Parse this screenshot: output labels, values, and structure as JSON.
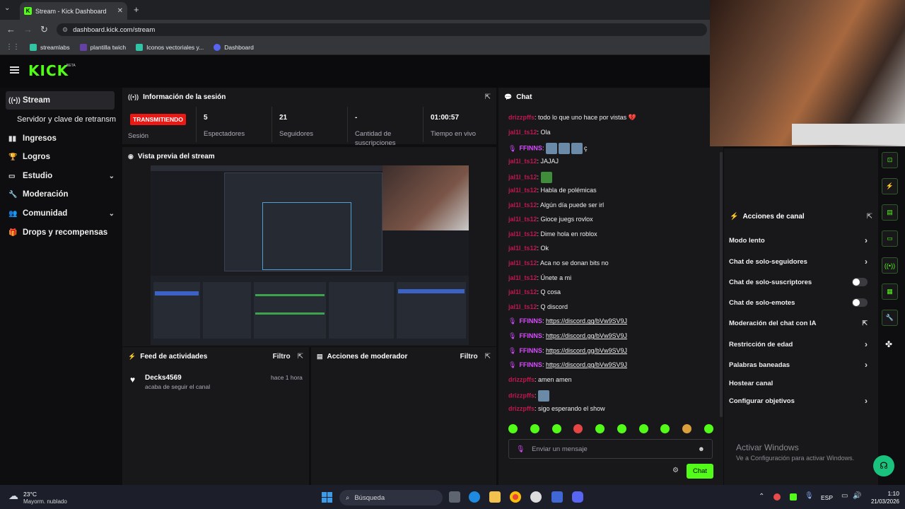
{
  "browser": {
    "tab_title": "Stream - Kick Dashboard",
    "url": "dashboard.kick.com/stream",
    "bookmarks": [
      "streamlabs",
      "plantilla twich",
      "Iconos vectoriales y...",
      "Dashboard"
    ]
  },
  "brand": {
    "logo": "KICK",
    "beta": "BETA",
    "accent": "#53fc18"
  },
  "sidebar": {
    "items": [
      {
        "label": "Stream",
        "icon": "broadcast-icon"
      },
      {
        "label": "Servidor y clave de retransm",
        "icon": ""
      },
      {
        "label": "Ingresos",
        "icon": "chart-icon"
      },
      {
        "label": "Logros",
        "icon": "trophy-icon"
      },
      {
        "label": "Estudio",
        "icon": "studio-icon"
      },
      {
        "label": "Moderación",
        "icon": "wrench-icon"
      },
      {
        "label": "Comunidad",
        "icon": "people-icon"
      },
      {
        "label": "Drops y recompensas",
        "icon": "gift-icon"
      }
    ]
  },
  "session": {
    "title": "Información de la sesión",
    "status": "TRANSMITIENDO",
    "status_label": "Sesión",
    "stats": [
      {
        "value": "5",
        "label": "Espectadores"
      },
      {
        "value": "21",
        "label": "Seguidores"
      },
      {
        "value": "-",
        "label": "Cantidad de suscripciones"
      },
      {
        "value": "01:00:57",
        "label": "Tiempo en vivo"
      }
    ]
  },
  "preview": {
    "title": "Vista previa del stream"
  },
  "activity": {
    "title": "Feed de actividades",
    "filter": "Filtro",
    "items": [
      {
        "user": "Decks4569",
        "action": "acaba de seguir el canal",
        "time": "hace 1 hora"
      }
    ]
  },
  "modactions": {
    "title": "Acciones de moderador",
    "filter": "Filtro"
  },
  "chat": {
    "title": "Chat",
    "messages": [
      {
        "user": "drizzpffs",
        "text": "todo lo que uno hace por vistas 💔",
        "color": "#c2174f"
      },
      {
        "user": "jal1l_ts12",
        "text": "Ola",
        "color": "#c2174f"
      },
      {
        "user": "FFINNS",
        "text": "ç",
        "color": "#d94bff"
      },
      {
        "user": "jal1l_ts12",
        "text": "JAJAJ",
        "color": "#c2174f"
      },
      {
        "user": "jal1l_ts12",
        "text": "",
        "color": "#c2174f"
      },
      {
        "user": "jal1l_ts12",
        "text": "Habla de polémicas",
        "color": "#c2174f"
      },
      {
        "user": "jal1l_ts12",
        "text": "Algún día puede ser irl",
        "color": "#c2174f"
      },
      {
        "user": "jal1l_ts12",
        "text": "Gioce juegs rovlox",
        "color": "#c2174f"
      },
      {
        "user": "jal1l_ts12",
        "text": "Dime hola en roblox",
        "color": "#c2174f"
      },
      {
        "user": "jal1l_ts12",
        "text": "Ok",
        "color": "#c2174f"
      },
      {
        "user": "jal1l_ts12",
        "text": "Aca no se donan bits no",
        "color": "#c2174f"
      },
      {
        "user": "jal1l_ts12",
        "text": "Únete a mi",
        "color": "#c2174f"
      },
      {
        "user": "jal1l_ts12",
        "text": "Q cosa",
        "color": "#c2174f"
      },
      {
        "user": "jal1l_ts12",
        "text": "Q discord",
        "color": "#c2174f"
      },
      {
        "user": "FFINNS",
        "text": "https://discord.gg/bVw9SV9J",
        "color": "#d94bff"
      },
      {
        "user": "FFINNS",
        "text": "https://discord.gg/bVw9SV9J",
        "color": "#d94bff"
      },
      {
        "user": "FFINNS",
        "text": "https://discord.gg/bVw9SV9J",
        "color": "#d94bff"
      },
      {
        "user": "FFINNS",
        "text": "https://discord.gg/bVw9SV9J",
        "color": "#d94bff"
      },
      {
        "user": "drizzpffs",
        "text": "amen amen",
        "color": "#c2174f"
      },
      {
        "user": "drizzpffs",
        "text": "",
        "color": "#c2174f"
      },
      {
        "user": "drizzpffs",
        "text": "sigo esperando el show",
        "color": "#c2174f"
      }
    ],
    "placeholder": "Enviar un mensaje",
    "send_label": "Chat"
  },
  "channel_actions": {
    "title": "Acciones de canal",
    "items": [
      {
        "label": "Modo lento",
        "control": "arrow"
      },
      {
        "label": "Chat de solo-seguidores",
        "control": "arrow"
      },
      {
        "label": "Chat de solo-suscriptores",
        "control": "toggle"
      },
      {
        "label": "Chat de solo-emotes",
        "control": "toggle"
      },
      {
        "label": "Moderación del chat con IA",
        "control": "external"
      },
      {
        "label": "Restricción de edad",
        "control": "arrow"
      },
      {
        "label": "Palabras baneadas",
        "control": "arrow"
      },
      {
        "label": "Hostear canal",
        "control": "none"
      },
      {
        "label": "Configurar objetivos",
        "control": "arrow"
      }
    ]
  },
  "watermark": {
    "title": "Activar Windows",
    "subtitle": "Ve a Configuración para activar Windows."
  },
  "taskbar": {
    "weather_temp": "23°C",
    "weather_desc": "Mayorm. nublado",
    "search": "Búsqueda",
    "lang": "ESP",
    "time": "1:10",
    "date": "21/03/2026"
  }
}
